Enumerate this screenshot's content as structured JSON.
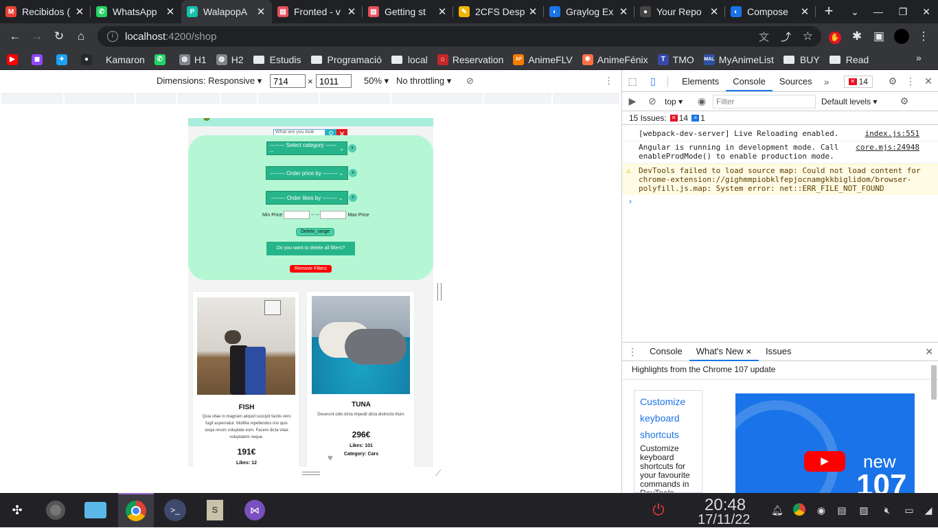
{
  "browser": {
    "tabs": [
      {
        "title": "Recibidos (",
        "icon": "gmail-icon",
        "color": "#ea4335",
        "glyph": "M"
      },
      {
        "title": "WhatsApp",
        "icon": "whatsapp-icon",
        "color": "#25d366",
        "glyph": "✆"
      },
      {
        "title": "WalapopA",
        "icon": "walapop-icon",
        "color": "#13c1ac",
        "glyph": "P"
      },
      {
        "title": "Fronted - v",
        "icon": "doc-icon",
        "color": "#e8505b",
        "glyph": "▤"
      },
      {
        "title": "Getting st",
        "icon": "doc-icon",
        "color": "#e8505b",
        "glyph": "▤"
      },
      {
        "title": "2CFS Desp",
        "icon": "pencil-icon",
        "color": "#f4b400",
        "glyph": "✎"
      },
      {
        "title": "Graylog Ex",
        "icon": "graylog-icon",
        "color": "#1a73e8",
        "glyph": "◐"
      },
      {
        "title": "Your Repo",
        "icon": "github-icon",
        "color": "#444",
        "glyph": "●"
      },
      {
        "title": "Compose",
        "icon": "compose-icon",
        "color": "#1a73e8",
        "glyph": "◐"
      }
    ],
    "active_tab": 2,
    "url_host": "localhost",
    "url_path": ":4200/shop",
    "bookmarks": [
      {
        "label": "",
        "icon": "youtube-icon"
      },
      {
        "label": "",
        "icon": "twitch-icon"
      },
      {
        "label": "",
        "icon": "twitter-icon"
      },
      {
        "label": "",
        "icon": "github-icon"
      },
      {
        "label": "Kamaron",
        "icon": "none"
      },
      {
        "label": "",
        "icon": "whatsapp-icon"
      },
      {
        "label": "H1",
        "icon": "globe-icon"
      },
      {
        "label": "H2",
        "icon": "globe-icon"
      },
      {
        "label": "Estudis",
        "icon": "folder-icon"
      },
      {
        "label": "Programació",
        "icon": "folder-icon"
      },
      {
        "label": "local",
        "icon": "folder-icon"
      },
      {
        "label": "Reservation",
        "icon": "reservation-icon"
      },
      {
        "label": "AnimeFLV",
        "icon": "animeflv-icon"
      },
      {
        "label": "AnimeFénix",
        "icon": "animefenix-icon"
      },
      {
        "label": "TMO",
        "icon": "tmo-icon"
      },
      {
        "label": "MyAnimeList",
        "icon": "mal-icon"
      },
      {
        "label": "BUY",
        "icon": "folder-icon"
      },
      {
        "label": "Read",
        "icon": "folder-icon"
      }
    ]
  },
  "device_toolbar": {
    "dimensions_label": "Dimensions: Responsive",
    "width": "714",
    "height": "1011",
    "zoom": "50%",
    "throttling": "No throttling"
  },
  "site": {
    "search_placeholder": "What are you look",
    "select_category": "-------- Select category --------",
    "order_price": "-------- Order price by --------",
    "order_likes": "-------- Order likes by --------",
    "x_label": "x",
    "min_price": "Min Price",
    "range_sep": "-- --",
    "max_price": "Max Price",
    "delete_range": "Delete_range",
    "delete_all": "Do you want to delete all filters?",
    "remove_filters": "Remove Filters",
    "products": [
      {
        "title": "FISH",
        "desc": "Quia vitae in magnam aliquid suscipit facilis vero fugit aspernatur. Mollitia repellendus nisi quis sequi rerum voluptate eum. Facere dicta vitae voluptatem neque.",
        "price": "191€",
        "likes": "Likes: 12",
        "category": ""
      },
      {
        "title": "TUNA",
        "desc": "Deserunt odio dicta impedit dicta distinctio illum.",
        "price": "296€",
        "likes": "Likes: 101",
        "category": "Category: Cars"
      }
    ]
  },
  "devtools": {
    "tabs": [
      "Elements",
      "Console",
      "Sources"
    ],
    "active_tab": "Console",
    "error_count": "14",
    "context": "top",
    "filter_placeholder": "Filter",
    "levels": "Default levels",
    "issues_label": "15 Issues:",
    "issues_errors": "14",
    "issues_info": "1",
    "messages": [
      {
        "text": "[webpack-dev-server] Live Reloading enabled.",
        "source": "index.js:551",
        "type": "log"
      },
      {
        "text": "Angular is running in development mode. Call enableProdMode() to enable production mode.",
        "source": "core.mjs:24948",
        "type": "log"
      },
      {
        "text": "DevTools failed to load source map: Could not load content for chrome-extension://gighmmpiobklfepjocnamgkkbiglidom/browser-polyfill.js.map: System error: net::ERR_FILE_NOT_FOUND",
        "source": "",
        "type": "warning"
      }
    ],
    "drawer_tabs": [
      "Console",
      "What's New",
      "Issues"
    ],
    "drawer_active": "What's New",
    "highlights": "Highlights from the Chrome 107 update",
    "news_link": "Customize keyboard shortcuts",
    "news_desc": "Customize keyboard shortcuts for your favourite commands in DevTools.",
    "video_text": "new",
    "video_num": "107"
  },
  "taskbar": {
    "time": "20:48",
    "date": "17/11/22"
  }
}
